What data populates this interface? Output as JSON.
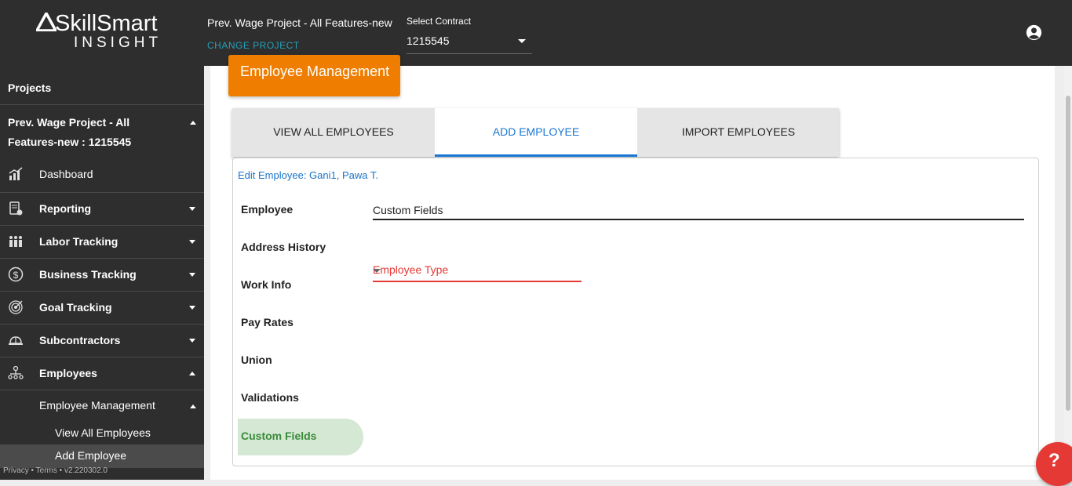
{
  "header": {
    "logo_word": "SkillSmart",
    "logo_sub": "INSIGHT",
    "project_name": "Prev. Wage Project - All Features-new",
    "change_project": "CHANGE PROJECT",
    "contract_label": "Select Contract",
    "contract_value": "1215545"
  },
  "sidebar": {
    "projects_label": "Projects",
    "project_name": "Prev. Wage Project - All Features-new : 1215545",
    "items": [
      {
        "label": "Dashboard",
        "icon": "dashboard-chart-icon"
      },
      {
        "label": "Reporting",
        "icon": "report-icon"
      },
      {
        "label": "Labor Tracking",
        "icon": "people-group-icon"
      },
      {
        "label": "Business Tracking",
        "icon": "dollar-circle-icon"
      },
      {
        "label": "Goal Tracking",
        "icon": "target-icon"
      },
      {
        "label": "Subcontractors",
        "icon": "hard-hat-icon"
      },
      {
        "label": "Employees",
        "icon": "org-chart-icon"
      }
    ],
    "sub_section": "Employee Management",
    "sub_items": [
      "View All Employees",
      "Add Employee"
    ],
    "footer": "Privacy • Terms • v2.220302.0"
  },
  "main": {
    "page_title": "Employee Management",
    "tabs": [
      "VIEW ALL EMPLOYEES",
      "ADD EMPLOYEE",
      "IMPORT EMPLOYEES"
    ],
    "active_tab": "ADD EMPLOYEE",
    "edit_title": "Edit Employee: Gani1, Pawa T.",
    "vertical_nav": [
      "Employee",
      "Address History",
      "Work Info",
      "Pay Rates",
      "Union",
      "Validations",
      "Custom Fields"
    ],
    "active_section": "Custom Fields",
    "section_title": "Custom Fields",
    "employee_type_label": "Employee Type",
    "help_label": "?"
  },
  "colors": {
    "topbar": "#2e2e2e",
    "accent_orange": "#ef7d00",
    "accent_blue": "#1976d2",
    "teal_link": "#25a0b8",
    "error_red": "#e53935",
    "active_green_bg": "#d4e8d4"
  }
}
